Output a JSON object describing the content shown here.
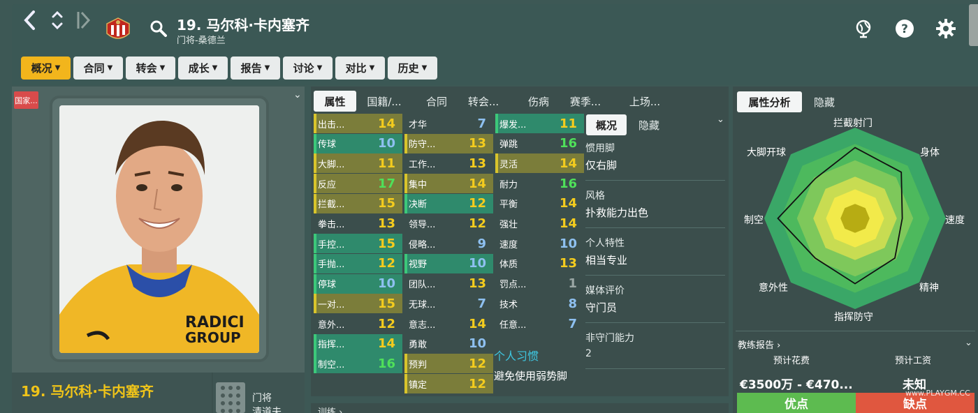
{
  "header": {
    "player_title": "19. 马尔科·卡内塞齐",
    "subtitle": "门将-桑德兰",
    "icons": [
      "back-icon",
      "up-down-icon",
      "next-icon",
      "club-crest-icon",
      "search-icon",
      "globe-icon",
      "help-icon",
      "settings-icon"
    ]
  },
  "tabs": [
    {
      "label": "概况",
      "active": true
    },
    {
      "label": "合同"
    },
    {
      "label": "转会"
    },
    {
      "label": "成长"
    },
    {
      "label": "报告"
    },
    {
      "label": "讨论"
    },
    {
      "label": "对比"
    },
    {
      "label": "历史"
    }
  ],
  "left": {
    "flag_tag": "国家...",
    "name": "19. 马尔科·卡内塞齐",
    "position": "门将",
    "position2": "清道夫"
  },
  "attr_tabs": [
    "属性",
    "国籍/...",
    "合同",
    "转会...",
    "伤病",
    "赛季...",
    "上场..."
  ],
  "attributes": {
    "col1": [
      {
        "label": "出击...",
        "value": "14",
        "color": "yellow",
        "bg": "olive"
      },
      {
        "label": "传球",
        "value": "10",
        "color": "blue",
        "bg": "teal"
      },
      {
        "label": "大脚...",
        "value": "11",
        "color": "yellow",
        "bg": "olive"
      },
      {
        "label": "反应",
        "value": "17",
        "color": "green",
        "bg": "olive"
      },
      {
        "label": "拦截...",
        "value": "15",
        "color": "yellow",
        "bg": "olive"
      },
      {
        "label": "拳击...",
        "value": "13",
        "color": "yellow",
        "bg": "none"
      },
      {
        "label": "手控...",
        "value": "15",
        "color": "yellow",
        "bg": "teal"
      },
      {
        "label": "手抛...",
        "value": "12",
        "color": "yellow",
        "bg": "teal"
      },
      {
        "label": "停球",
        "value": "10",
        "color": "blue",
        "bg": "teal"
      },
      {
        "label": "一对...",
        "value": "15",
        "color": "yellow",
        "bg": "olive"
      },
      {
        "label": "意外...",
        "value": "12",
        "color": "yellow",
        "bg": "none"
      },
      {
        "label": "指挥...",
        "value": "14",
        "color": "yellow",
        "bg": "teal"
      },
      {
        "label": "制空...",
        "value": "16",
        "color": "green",
        "bg": "teal"
      }
    ],
    "col2": [
      {
        "label": "才华",
        "value": "7",
        "color": "blue",
        "bg": "none"
      },
      {
        "label": "防守...",
        "value": "13",
        "color": "yellow",
        "bg": "olive"
      },
      {
        "label": "工作...",
        "value": "13",
        "color": "yellow",
        "bg": "none"
      },
      {
        "label": "集中",
        "value": "14",
        "color": "yellow",
        "bg": "olive"
      },
      {
        "label": "决断",
        "value": "12",
        "color": "yellow",
        "bg": "teal"
      },
      {
        "label": "领导...",
        "value": "12",
        "color": "yellow",
        "bg": "none"
      },
      {
        "label": "侵略...",
        "value": "9",
        "color": "blue",
        "bg": "none"
      },
      {
        "label": "视野",
        "value": "10",
        "color": "blue",
        "bg": "teal"
      },
      {
        "label": "团队...",
        "value": "13",
        "color": "yellow",
        "bg": "none"
      },
      {
        "label": "无球...",
        "value": "7",
        "color": "blue",
        "bg": "none"
      },
      {
        "label": "意志...",
        "value": "14",
        "color": "yellow",
        "bg": "none"
      },
      {
        "label": "勇敢",
        "value": "10",
        "color": "blue",
        "bg": "none"
      },
      {
        "label": "预判",
        "value": "12",
        "color": "yellow",
        "bg": "olive"
      },
      {
        "label": "镇定",
        "value": "12",
        "color": "yellow",
        "bg": "olive"
      }
    ],
    "col3": [
      {
        "label": "爆发...",
        "value": "11",
        "color": "yellow",
        "bg": "teal"
      },
      {
        "label": "弹跳",
        "value": "16",
        "color": "green",
        "bg": "none"
      },
      {
        "label": "灵活",
        "value": "14",
        "color": "yellow",
        "bg": "olive"
      },
      {
        "label": "耐力",
        "value": "16",
        "color": "green",
        "bg": "none"
      },
      {
        "label": "平衡",
        "value": "14",
        "color": "yellow",
        "bg": "none"
      },
      {
        "label": "强壮",
        "value": "14",
        "color": "yellow",
        "bg": "none"
      },
      {
        "label": "速度",
        "value": "10",
        "color": "blue",
        "bg": "none"
      },
      {
        "label": "体质",
        "value": "13",
        "color": "yellow",
        "bg": "none"
      },
      {
        "label": "罚点...",
        "value": "1",
        "color": "gray",
        "bg": "none"
      },
      {
        "label": "技术",
        "value": "8",
        "color": "blue",
        "bg": "none"
      },
      {
        "label": "任意...",
        "value": "7",
        "color": "blue",
        "bg": "none"
      }
    ]
  },
  "habits": {
    "title": "个人习惯",
    "items": [
      "避免使用弱势脚"
    ]
  },
  "overview": {
    "tabs": [
      "概况",
      "隐藏"
    ],
    "items": [
      {
        "label": "惯用脚",
        "value": "仅右脚"
      },
      {
        "label": "风格",
        "value": "扑救能力出色"
      },
      {
        "label": "个人特性",
        "value": "相当专业"
      },
      {
        "label": "媒体评价",
        "value": "守门员"
      },
      {
        "label": "非守门能力",
        "value": "2"
      }
    ]
  },
  "training_label": "训练",
  "analysis": {
    "tabs": [
      "属性分析",
      "隐藏"
    ],
    "labels": [
      "拦截射门",
      "身体",
      "速度",
      "精神",
      "指挥防守",
      "意外性",
      "制空",
      "大脚开球"
    ],
    "values_0_to_1": [
      0.78,
      0.72,
      0.52,
      0.62,
      0.72,
      0.62,
      0.85,
      0.62
    ],
    "coach_report": "教练报告",
    "fee_label": "预计花费",
    "fee_value": "€3500万 - €470...",
    "wage_label": "预计工资",
    "wage_value": "未知",
    "pros": "优点",
    "cons": "缺点"
  },
  "watermark": "www.PLAYGM.CC",
  "colors": {
    "accent": "#f2b51c",
    "yellow": "#f4cc1e",
    "green": "#4fe05a",
    "blue": "#8ec0f0",
    "teal_bg": "#2f8a6c",
    "olive_bg": "#7b7d3a"
  }
}
